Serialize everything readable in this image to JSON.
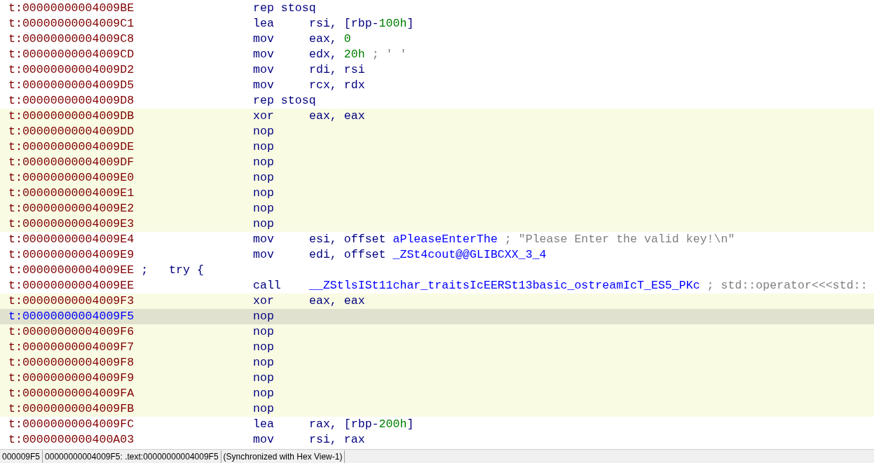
{
  "lines": [
    {
      "kind": "insn",
      "address": "t:00000000004009BE",
      "highlighted": false,
      "selected": false,
      "mnemonic": "rep stosq"
    },
    {
      "kind": "insn",
      "address": "t:00000000004009C1",
      "highlighted": false,
      "selected": false,
      "mnemonic": "lea",
      "operands": [
        {
          "kind": "plain",
          "text": "rsi, [rbp-"
        },
        {
          "kind": "number",
          "text": "100h"
        },
        {
          "kind": "plain",
          "text": "]"
        }
      ]
    },
    {
      "kind": "insn",
      "address": "t:00000000004009C8",
      "highlighted": false,
      "selected": false,
      "mnemonic": "mov",
      "operands": [
        {
          "kind": "plain",
          "text": "eax, "
        },
        {
          "kind": "number",
          "text": "0"
        }
      ]
    },
    {
      "kind": "insn",
      "address": "t:00000000004009CD",
      "highlighted": false,
      "selected": false,
      "mnemonic": "mov",
      "operands": [
        {
          "kind": "plain",
          "text": "edx, "
        },
        {
          "kind": "number",
          "text": "20h"
        },
        {
          "kind": "comment",
          "text": " ; ' '"
        }
      ]
    },
    {
      "kind": "insn",
      "address": "t:00000000004009D2",
      "highlighted": false,
      "selected": false,
      "mnemonic": "mov",
      "operands": [
        {
          "kind": "plain",
          "text": "rdi, rsi"
        }
      ]
    },
    {
      "kind": "insn",
      "address": "t:00000000004009D5",
      "highlighted": false,
      "selected": false,
      "mnemonic": "mov",
      "operands": [
        {
          "kind": "plain",
          "text": "rcx, rdx"
        }
      ]
    },
    {
      "kind": "insn",
      "address": "t:00000000004009D8",
      "highlighted": false,
      "selected": false,
      "mnemonic": "rep stosq"
    },
    {
      "kind": "insn",
      "address": "t:00000000004009DB",
      "highlighted": true,
      "selected": false,
      "mnemonic": "xor",
      "operands": [
        {
          "kind": "plain",
          "text": "eax, eax"
        }
      ]
    },
    {
      "kind": "insn",
      "address": "t:00000000004009DD",
      "highlighted": true,
      "selected": false,
      "mnemonic": "nop"
    },
    {
      "kind": "insn",
      "address": "t:00000000004009DE",
      "highlighted": true,
      "selected": false,
      "mnemonic": "nop"
    },
    {
      "kind": "insn",
      "address": "t:00000000004009DF",
      "highlighted": true,
      "selected": false,
      "mnemonic": "nop"
    },
    {
      "kind": "insn",
      "address": "t:00000000004009E0",
      "highlighted": true,
      "selected": false,
      "mnemonic": "nop"
    },
    {
      "kind": "insn",
      "address": "t:00000000004009E1",
      "highlighted": true,
      "selected": false,
      "mnemonic": "nop"
    },
    {
      "kind": "insn",
      "address": "t:00000000004009E2",
      "highlighted": true,
      "selected": false,
      "mnemonic": "nop"
    },
    {
      "kind": "insn",
      "address": "t:00000000004009E3",
      "highlighted": true,
      "selected": false,
      "mnemonic": "nop"
    },
    {
      "kind": "insn",
      "address": "t:00000000004009E4",
      "highlighted": false,
      "selected": false,
      "mnemonic": "mov",
      "operands": [
        {
          "kind": "plain",
          "text": "esi, offset "
        },
        {
          "kind": "name",
          "text": "aPleaseEnterThe"
        },
        {
          "kind": "comment",
          "text": " ; \"Please Enter the valid key!\\n\""
        }
      ]
    },
    {
      "kind": "insn",
      "address": "t:00000000004009E9",
      "highlighted": false,
      "selected": false,
      "mnemonic": "mov",
      "operands": [
        {
          "kind": "plain",
          "text": "edi, offset "
        },
        {
          "kind": "name",
          "text": "_ZSt4cout@@GLIBCXX_3_4"
        }
      ]
    },
    {
      "kind": "label",
      "address": "t:00000000004009EE",
      "highlighted": false,
      "selected": false,
      "text": ";   try {"
    },
    {
      "kind": "insn",
      "address": "t:00000000004009EE",
      "highlighted": false,
      "selected": false,
      "mnemonic": "call",
      "operands": [
        {
          "kind": "name",
          "text": "__ZStlsISt11char_traitsIcEERSt13basic_ostreamIcT_ES5_PKc"
        },
        {
          "kind": "comment",
          "text": " ; std::operator<<<std::"
        }
      ]
    },
    {
      "kind": "insn",
      "address": "t:00000000004009F3",
      "highlighted": true,
      "selected": false,
      "mnemonic": "xor",
      "operands": [
        {
          "kind": "plain",
          "text": "eax, eax"
        }
      ]
    },
    {
      "kind": "insn",
      "address": "t:00000000004009F5",
      "highlighted": true,
      "selected": true,
      "mnemonic": "nop"
    },
    {
      "kind": "insn",
      "address": "t:00000000004009F6",
      "highlighted": true,
      "selected": false,
      "mnemonic": "nop"
    },
    {
      "kind": "insn",
      "address": "t:00000000004009F7",
      "highlighted": true,
      "selected": false,
      "mnemonic": "nop"
    },
    {
      "kind": "insn",
      "address": "t:00000000004009F8",
      "highlighted": true,
      "selected": false,
      "mnemonic": "nop"
    },
    {
      "kind": "insn",
      "address": "t:00000000004009F9",
      "highlighted": true,
      "selected": false,
      "mnemonic": "nop"
    },
    {
      "kind": "insn",
      "address": "t:00000000004009FA",
      "highlighted": true,
      "selected": false,
      "mnemonic": "nop"
    },
    {
      "kind": "insn",
      "address": "t:00000000004009FB",
      "highlighted": true,
      "selected": false,
      "mnemonic": "nop"
    },
    {
      "kind": "insn",
      "address": "t:00000000004009FC",
      "highlighted": false,
      "selected": false,
      "mnemonic": "lea",
      "operands": [
        {
          "kind": "plain",
          "text": "rax, [rbp-"
        },
        {
          "kind": "number",
          "text": "200h"
        },
        {
          "kind": "plain",
          "text": "]"
        }
      ]
    },
    {
      "kind": "insn",
      "address": "t:0000000000400A03",
      "highlighted": false,
      "selected": false,
      "mnemonic": "mov",
      "operands": [
        {
          "kind": "plain",
          "text": "rsi, rax"
        }
      ]
    }
  ],
  "status_bar": [
    "000009F5",
    "00000000004009F5: .text:00000000004009F5",
    "(Synchronized with Hex View-1)"
  ]
}
